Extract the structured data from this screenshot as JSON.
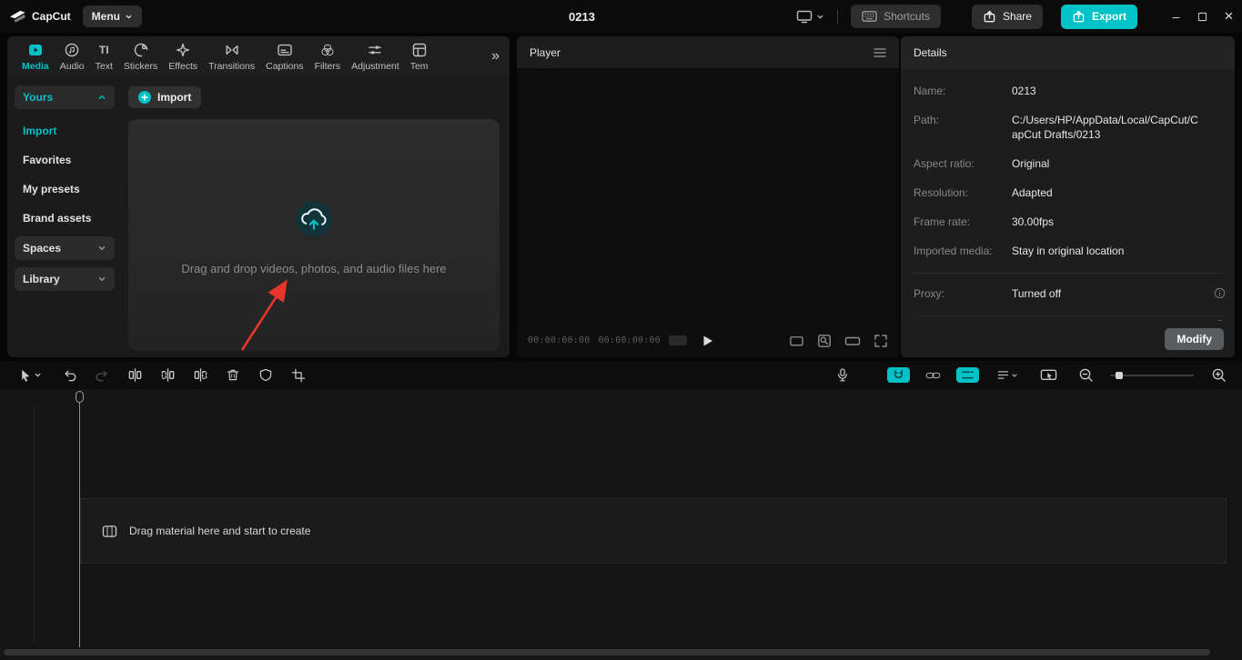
{
  "colors": {
    "accent": "#00c2c7",
    "annotation_arrow": "#e8352b"
  },
  "titlebar": {
    "app_name": "CapCut",
    "menu": "Menu",
    "project_title": "0213",
    "shortcuts": "Shortcuts",
    "share": "Share",
    "export": "Export"
  },
  "icons": {
    "window_minimize": "–",
    "window_close": "×",
    "collapse_chevrons": "»",
    "text_tab_glyph": "TI"
  },
  "media_panel": {
    "tabs": [
      {
        "label": "Media",
        "active": true
      },
      {
        "label": "Audio",
        "active": false
      },
      {
        "label": "Text",
        "active": false
      },
      {
        "label": "Stickers",
        "active": false
      },
      {
        "label": "Effects",
        "active": false
      },
      {
        "label": "Transitions",
        "active": false
      },
      {
        "label": "Captions",
        "active": false
      },
      {
        "label": "Filters",
        "active": false
      },
      {
        "label": "Adjustment",
        "active": false
      },
      {
        "label": "Tem",
        "active": false
      }
    ],
    "sidebar": [
      {
        "label": "Yours"
      },
      {
        "label": "Import"
      },
      {
        "label": "Favorites"
      },
      {
        "label": "My presets"
      },
      {
        "label": "Brand assets"
      },
      {
        "label": "Spaces"
      },
      {
        "label": "Library"
      }
    ],
    "import_button": "Import",
    "dropzone_hint": "Drag and drop videos, photos, and audio files here"
  },
  "player": {
    "title": "Player",
    "timecode_current": "00:00:00:00",
    "timecode_total": "00:00:00:00"
  },
  "details": {
    "title": "Details",
    "rows": [
      {
        "label": "Name:",
        "value": "0213"
      },
      {
        "label": "Path:",
        "value": "C:/Users/HP/AppData/Local/CapCut/CapCut Drafts/0213"
      },
      {
        "label": "Aspect ratio:",
        "value": "Original"
      },
      {
        "label": "Resolution:",
        "value": "Adapted"
      },
      {
        "label": "Frame rate:",
        "value": "30.00fps"
      },
      {
        "label": "Imported media:",
        "value": "Stay in original location"
      },
      {
        "label": "Proxy:",
        "value": "Turned off"
      }
    ],
    "modify_button": "Modify"
  },
  "timeline": {
    "empty_hint": "Drag material here and start to create"
  }
}
